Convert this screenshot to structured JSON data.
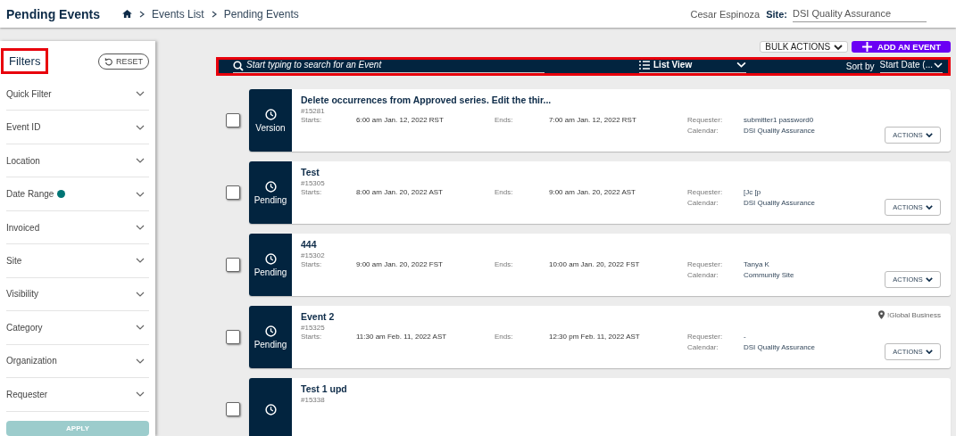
{
  "header": {
    "title": "Pending Events",
    "breadcrumb": [
      {
        "label": "Events List"
      },
      {
        "label": "Pending Events"
      }
    ],
    "user": "Cesar Espinoza",
    "site_label": "Site:",
    "site_value": "DSI Quality Assurance"
  },
  "filters": {
    "title": "Filters",
    "highlighted": true,
    "reset": "RESET",
    "apply": "APPLY",
    "apply_disabled": true,
    "items": [
      {
        "label": "Quick Filter",
        "active": false
      },
      {
        "label": "Event ID",
        "active": false
      },
      {
        "label": "Location",
        "active": false
      },
      {
        "label": "Date Range",
        "active": true
      },
      {
        "label": "Invoiced",
        "active": false
      },
      {
        "label": "Site",
        "active": false
      },
      {
        "label": "Visibility",
        "active": false
      },
      {
        "label": "Category",
        "active": false
      },
      {
        "label": "Organization",
        "active": false
      },
      {
        "label": "Requester",
        "active": false
      }
    ]
  },
  "toolbar": {
    "bulk_actions": "BULK ACTIONS",
    "add_event": "ADD AN EVENT"
  },
  "search_bar": {
    "highlighted": true,
    "placeholder": "Start typing to search for an Event",
    "view": "List View",
    "sort_label": "Sort by",
    "sort_value": "Start Date (..."
  },
  "events": [
    {
      "status": "Version",
      "title": "Delete occurrences from Approved series. Edit the thir...",
      "id": "#15281",
      "starts_label": "Starts:",
      "starts": "6:00 am Jan. 12, 2022 RST",
      "ends_label": "Ends:",
      "ends": "7:00 am Jan. 12, 2022 RST",
      "requester_label": "Requester:",
      "requester": "submitter1 password0",
      "calendar_label": "Calendar:",
      "calendar": "DSI Quality Assurance",
      "actions": "ACTIONS",
      "checked": false
    },
    {
      "status": "Pending",
      "title": "Test",
      "id": "#15305",
      "starts_label": "Starts:",
      "starts": "8:00 am Jan. 20, 2022 AST",
      "ends_label": "Ends:",
      "ends": "9:00 am Jan. 20, 2022 AST",
      "requester_label": "Requester:",
      "requester": "[Jc [p",
      "calendar_label": "Calendar:",
      "calendar": "DSI Quality Assurance",
      "actions": "ACTIONS",
      "checked": false
    },
    {
      "status": "Pending",
      "title": "444",
      "id": "#15302",
      "starts_label": "Starts:",
      "starts": "9:00 am Jan. 20, 2022 FST",
      "ends_label": "Ends:",
      "ends": "10:00 am Jan. 20, 2022 FST",
      "requester_label": "Requester:",
      "requester": "Tanya K",
      "calendar_label": "Calendar:",
      "calendar": "Community Site",
      "actions": "ACTIONS",
      "checked": false
    },
    {
      "status": "Pending",
      "title": "Event 2",
      "id": "#15325",
      "location": "!Global Business",
      "starts_label": "Starts:",
      "starts": "11:30 am Feb. 11, 2022 AST",
      "ends_label": "Ends:",
      "ends": "12:30 pm Feb. 11, 2022 AST",
      "requester_label": "Requester:",
      "requester": "-",
      "calendar_label": "Calendar:",
      "calendar": "DSI Quality Assurance",
      "actions": "ACTIONS",
      "checked": false
    },
    {
      "title": "Test 1 upd",
      "id": "#15338",
      "checked": false
    }
  ]
}
